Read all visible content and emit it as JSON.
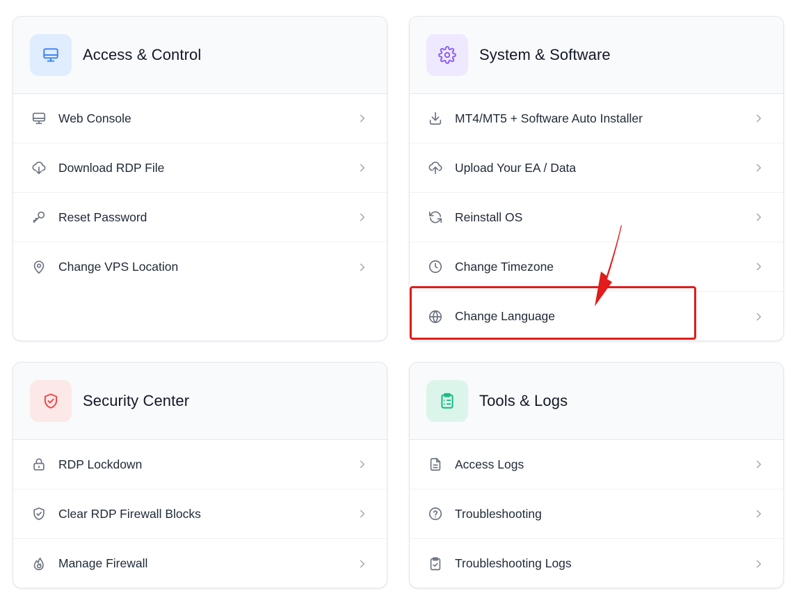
{
  "colors": {
    "access_icon_bg": "#e0ecff",
    "access_icon": "#3b82f6",
    "system_icon_bg": "#efe9ff",
    "system_icon": "#8b5cf6",
    "security_icon_bg": "#fde8e8",
    "security_icon": "#ef4444",
    "tools_icon_bg": "#dcf5ea",
    "tools_icon": "#10b981",
    "annotation": "#e21b1b"
  },
  "cards": {
    "access": {
      "title": "Access & Control",
      "icon": "monitor-icon",
      "items": [
        {
          "label": "Web Console",
          "icon": "monitor-icon"
        },
        {
          "label": "Download RDP File",
          "icon": "cloud-download-icon"
        },
        {
          "label": "Reset Password",
          "icon": "key-icon"
        },
        {
          "label": "Change VPS Location",
          "icon": "map-pin-icon"
        }
      ]
    },
    "system": {
      "title": "System & Software",
      "icon": "gear-icon",
      "items": [
        {
          "label": "MT4/MT5 + Software Auto Installer",
          "icon": "download-icon"
        },
        {
          "label": "Upload Your EA / Data",
          "icon": "cloud-upload-icon"
        },
        {
          "label": "Reinstall OS",
          "icon": "refresh-icon"
        },
        {
          "label": "Change Timezone",
          "icon": "clock-icon"
        },
        {
          "label": "Change Language",
          "icon": "globe-icon"
        }
      ]
    },
    "security": {
      "title": "Security Center",
      "icon": "shield-check-icon",
      "items": [
        {
          "label": "RDP Lockdown",
          "icon": "lock-icon"
        },
        {
          "label": "Clear RDP Firewall Blocks",
          "icon": "shield-check-icon"
        },
        {
          "label": "Manage Firewall",
          "icon": "flame-icon"
        }
      ]
    },
    "tools": {
      "title": "Tools & Logs",
      "icon": "clipboard-list-icon",
      "items": [
        {
          "label": "Access Logs",
          "icon": "file-text-icon"
        },
        {
          "label": "Troubleshooting",
          "icon": "help-circle-icon"
        },
        {
          "label": "Troubleshooting Logs",
          "icon": "clipboard-check-icon"
        }
      ]
    }
  }
}
